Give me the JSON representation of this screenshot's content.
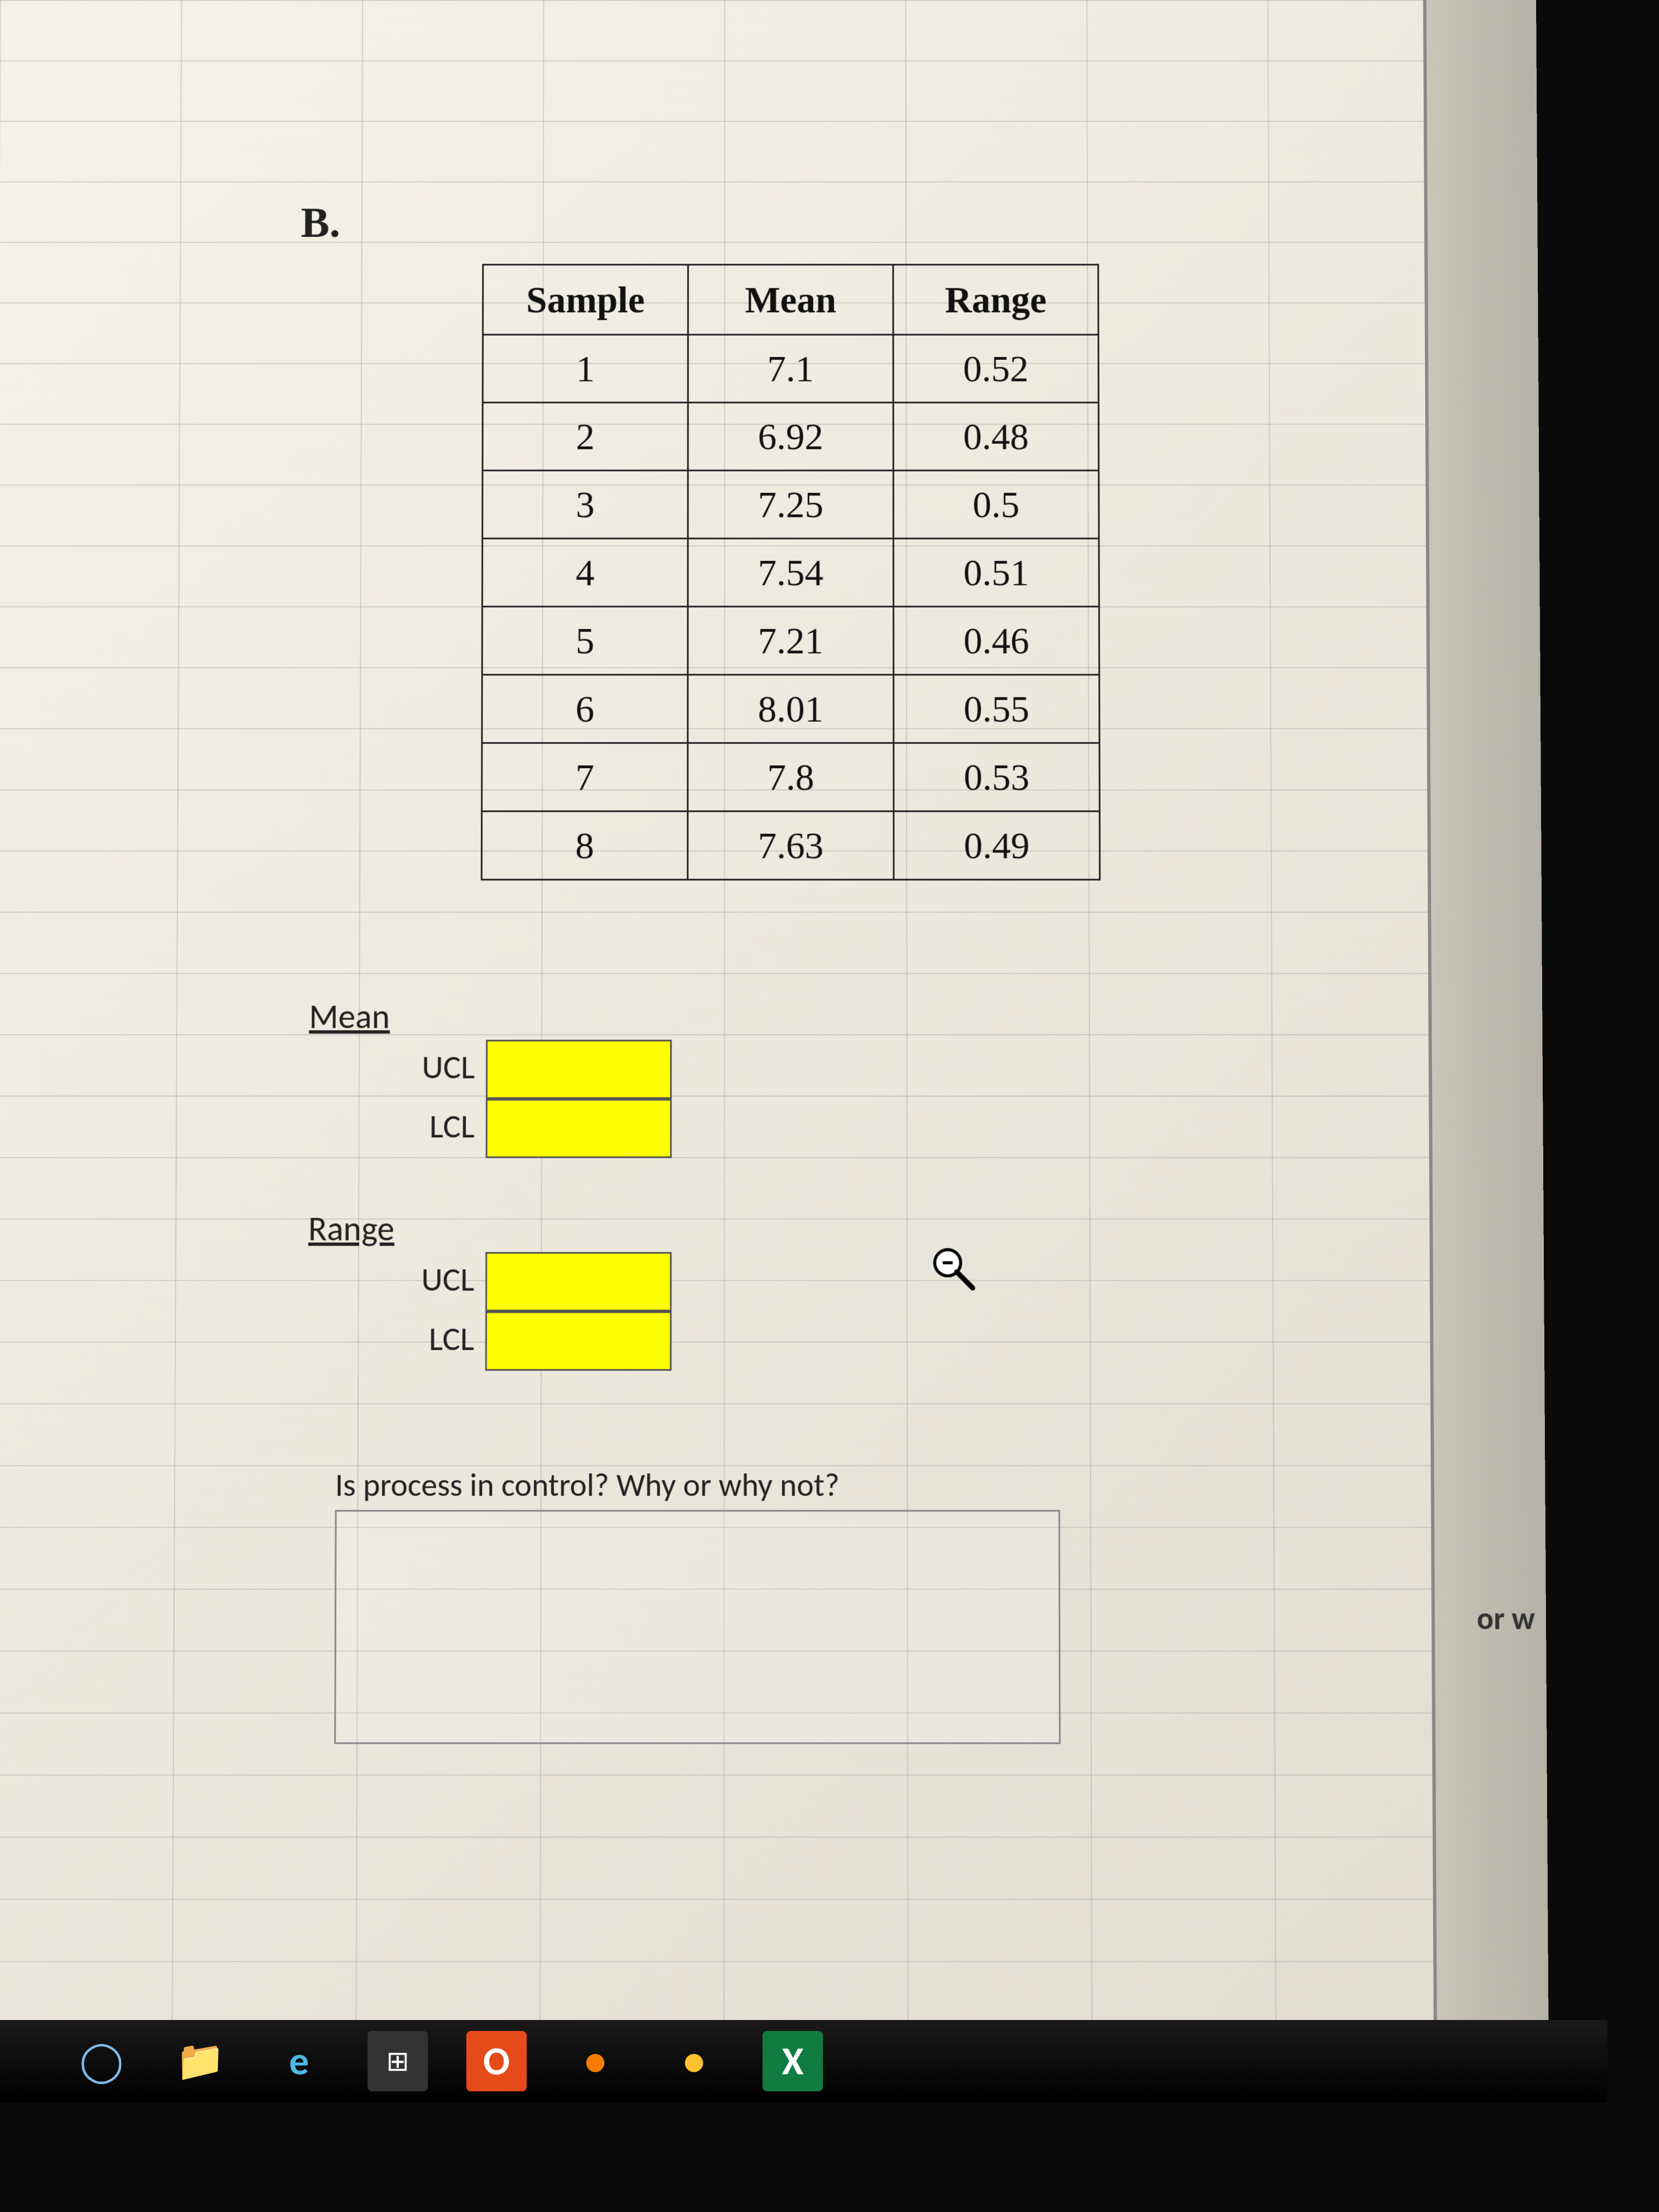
{
  "section_label": "B.",
  "table": {
    "headers": [
      "Sample",
      "Mean",
      "Range"
    ],
    "rows": [
      {
        "sample": "1",
        "mean": "7.1",
        "range": "0.52"
      },
      {
        "sample": "2",
        "mean": "6.92",
        "range": "0.48"
      },
      {
        "sample": "3",
        "mean": "7.25",
        "range": "0.5"
      },
      {
        "sample": "4",
        "mean": "7.54",
        "range": "0.51"
      },
      {
        "sample": "5",
        "mean": "7.21",
        "range": "0.46"
      },
      {
        "sample": "6",
        "mean": "8.01",
        "range": "0.55"
      },
      {
        "sample": "7",
        "mean": "7.8",
        "range": "0.53"
      },
      {
        "sample": "8",
        "mean": "7.63",
        "range": "0.49"
      }
    ]
  },
  "mean_block": {
    "title": "Mean",
    "ucl_label": "UCL",
    "lcl_label": "LCL",
    "ucl_value": "",
    "lcl_value": ""
  },
  "range_block": {
    "title": "Range",
    "ucl_label": "UCL",
    "lcl_label": "LCL",
    "ucl_value": "",
    "lcl_value": ""
  },
  "question_text": "Is process in control? Why or why not?",
  "side_text": "or w",
  "taskbar": {
    "cortana": "◯",
    "explorer": "📁",
    "edge": "e",
    "store": "⊞",
    "office": "O",
    "app1": "●",
    "chrome": "●",
    "excel": "X"
  }
}
